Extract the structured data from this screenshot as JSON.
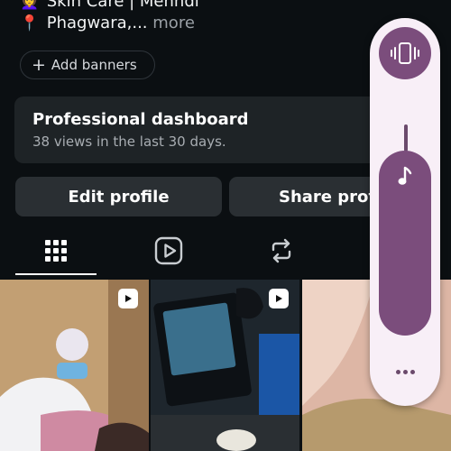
{
  "bio": {
    "line1_emoji": "👩‍🦱",
    "line1_text": "Skin Care | Mehndi",
    "line2_emoji": "📍",
    "line2_text": "Phagwara,...",
    "more_label": "more"
  },
  "banners": {
    "add_label": "Add banners"
  },
  "dashboard": {
    "title": "Professional dashboard",
    "subtitle": "38 views in the last 30 days."
  },
  "actions": {
    "edit_label": "Edit profile",
    "share_label": "Share profile"
  },
  "tabs": [
    {
      "icon": "grid-icon",
      "selected": true
    },
    {
      "icon": "reels-icon",
      "selected": false
    },
    {
      "icon": "reposts-icon",
      "selected": false
    }
  ],
  "volume": {
    "mode_icon": "vibrate-icon",
    "stream_icon": "music-note-icon",
    "level": 0.81,
    "more_icon": "more-dots-icon",
    "colors": {
      "panel": "#f8eff7",
      "accent": "#7b4d7c"
    }
  },
  "posts": [
    {
      "badge_icon": "reel-badge-icon"
    },
    {
      "badge_icon": "reel-badge-icon"
    },
    {
      "badge_icon": "none"
    }
  ]
}
